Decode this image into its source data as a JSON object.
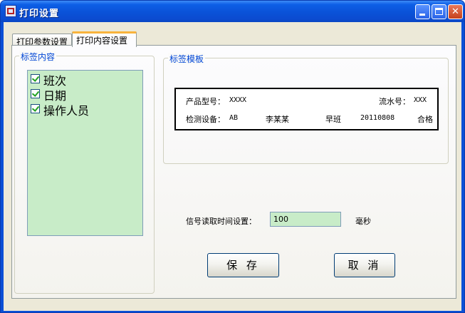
{
  "window": {
    "title": "打印设置",
    "icon": "app-icon"
  },
  "titlebar_buttons": {
    "minimize": "minimize-icon",
    "maximize": "maximize-icon",
    "close": "close-icon",
    "close_glyph": "✕"
  },
  "tabs": [
    {
      "label": "打印参数设置",
      "active": false
    },
    {
      "label": "打印内容设置",
      "active": true
    }
  ],
  "label_content": {
    "legend": "标签内容",
    "items": [
      {
        "label": "班次",
        "checked": true
      },
      {
        "label": "日期",
        "checked": true
      },
      {
        "label": "操作人员",
        "checked": true
      }
    ]
  },
  "label_template": {
    "legend": "标签模板",
    "row1": {
      "model_label": "产品型号：",
      "model_value": "XXXX",
      "serial_label": "流水号：",
      "serial_value": "XXX"
    },
    "row2": {
      "device_label": "检测设备：",
      "device_value": "AB",
      "operator": "李某某",
      "shift": "早班",
      "date": "20110808",
      "result": "合格"
    }
  },
  "signal": {
    "label": "信号读取时间设置：",
    "value": "100",
    "unit": "毫秒"
  },
  "buttons": {
    "save": "保 存",
    "cancel": "取 消"
  },
  "colors": {
    "titlebar": "#0a52d8",
    "list_background": "#c8ecc8",
    "legend_text": "#0046d5",
    "active_tab_accent": "#f9b33c"
  }
}
